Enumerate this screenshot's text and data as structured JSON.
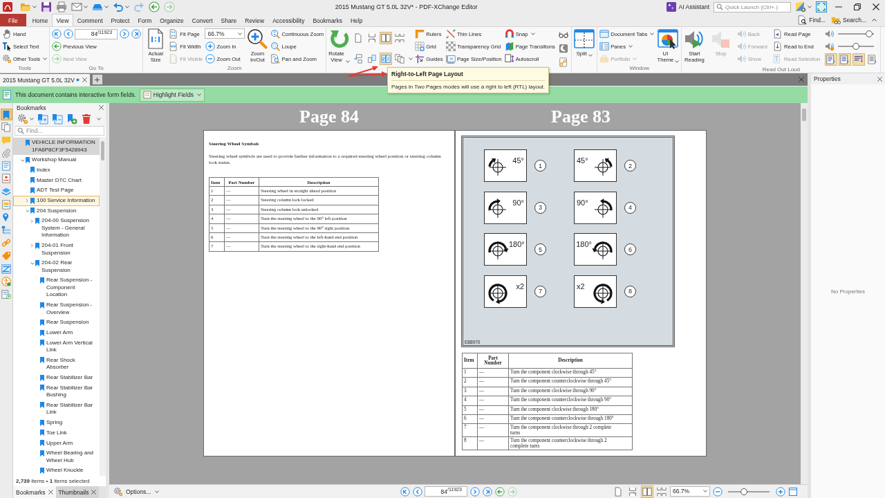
{
  "title_bar": {
    "quick_access": [
      {
        "disabled": false
      },
      {
        "disabled": false
      },
      {
        "disabled": false
      },
      {
        "disabled": false
      },
      {
        "disabled": false
      },
      {
        "disabled": false
      },
      {
        "disabled": true
      },
      {
        "disabled": false
      },
      {
        "disabled": true
      }
    ],
    "title": "2015 Mustang GT 5.0L 32V* - PDF-XChange Editor",
    "ai_button": "AI Assistant",
    "quick_launch": {
      "placeholder": "Quick Launch (Ctrl+.)"
    }
  },
  "menu": {
    "tabs": [
      {
        "label": "File",
        "kind": "file",
        "selected": false
      },
      {
        "label": "Home",
        "kind": "tab",
        "selected": false
      },
      {
        "label": "View",
        "kind": "tab",
        "selected": true
      },
      {
        "label": "Comment",
        "kind": "tab",
        "selected": false
      },
      {
        "label": "Protect",
        "kind": "tab",
        "selected": false
      },
      {
        "label": "Form",
        "kind": "tab",
        "selected": false
      },
      {
        "label": "Organize",
        "kind": "tab",
        "selected": false
      },
      {
        "label": "Convert",
        "kind": "tab",
        "selected": false
      },
      {
        "label": "Share",
        "kind": "tab",
        "selected": false
      },
      {
        "label": "Review",
        "kind": "tab",
        "selected": false
      },
      {
        "label": "Accessibility",
        "kind": "tab",
        "selected": false
      },
      {
        "label": "Bookmarks",
        "kind": "tab",
        "selected": false
      },
      {
        "label": "Help",
        "kind": "tab",
        "selected": false
      }
    ],
    "find": "Find...",
    "search": "Search..."
  },
  "ribbon": [
    {
      "title": "Tools",
      "columns": [
        [
          {
            "kind": "small",
            "label": "Hand",
            "menu": false,
            "disabled": false
          },
          {
            "kind": "small",
            "label": "Select Text",
            "menu": false,
            "disabled": false
          },
          {
            "kind": "small",
            "label": "Other Tools",
            "menu": true,
            "disabled": false
          }
        ]
      ]
    },
    {
      "title": "Go To",
      "columns": [
        [
          {
            "kind": "pager",
            "value": "84",
            "total": "/11923"
          },
          {
            "kind": "small",
            "label": "Previous View",
            "menu": false,
            "disabled": false
          },
          {
            "kind": "small",
            "label": "Next View",
            "menu": false,
            "disabled": true
          }
        ]
      ]
    },
    {
      "title": "Zoom",
      "columns": [
        [
          {
            "kind": "large",
            "label": "Actual Size",
            "menu": false,
            "disabled": false
          }
        ],
        [
          {
            "kind": "small",
            "label": "Fit Page",
            "menu": false,
            "disabled": false
          },
          {
            "kind": "small",
            "label": "Fit Width",
            "menu": false,
            "disabled": false
          },
          {
            "kind": "small",
            "label": "Fit Visible",
            "menu": false,
            "disabled": true
          }
        ],
        [
          {
            "kind": "combo",
            "value": "66.7%"
          },
          {
            "kind": "small",
            "label": "Zoom In",
            "menu": false,
            "disabled": false
          },
          {
            "kind": "small",
            "label": "Zoom Out",
            "menu": false,
            "disabled": false
          }
        ],
        [
          {
            "kind": "large",
            "label": "Zoom In/Out",
            "menu": false,
            "disabled": false
          }
        ],
        [
          {
            "kind": "small",
            "label": "Continuous Zoom",
            "menu": false,
            "disabled": false
          },
          {
            "kind": "small",
            "label": "Loupe",
            "menu": false,
            "disabled": false
          },
          {
            "kind": "small",
            "label": "Pan and Zoom",
            "menu": false,
            "disabled": false
          }
        ]
      ]
    },
    {
      "columns": [
        [
          {
            "kind": "large",
            "label": "Rotate View",
            "menu": true,
            "disabled": false
          }
        ],
        [
          {
            "kind": "icons",
            "menu": false,
            "buttons": [
              {
                "selected": false
              },
              {
                "selected": false
              },
              {
                "selected": true
              },
              {
                "selected": false
              }
            ]
          },
          {
            "kind": "icons",
            "menu": true,
            "buttons": [
              {
                "selected": false
              },
              {
                "selected": false
              },
              {
                "selected": true
              },
              {
                "selected": false
              }
            ]
          }
        ],
        [
          {
            "kind": "small",
            "label": "Rulers",
            "menu": false,
            "disabled": false
          },
          {
            "kind": "small",
            "label": "Grid",
            "menu": false,
            "disabled": false
          },
          {
            "kind": "small",
            "label": "Guides",
            "menu": false,
            "disabled": false
          }
        ],
        [
          {
            "kind": "small",
            "label": "Thin Lines",
            "menu": false,
            "disabled": false
          },
          {
            "kind": "small",
            "label": "Transparency Grid",
            "menu": false,
            "disabled": false
          },
          {
            "kind": "small",
            "label": "Page Size/Position",
            "menu": false,
            "disabled": false
          }
        ],
        [
          {
            "kind": "small",
            "label": "Snap",
            "menu": true,
            "disabled": false
          },
          {
            "kind": "small",
            "label": "Page Transitions",
            "menu": false,
            "disabled": false
          },
          {
            "kind": "small",
            "label": "Autoscroll",
            "menu": false,
            "disabled": false
          }
        ],
        [
          {
            "kind": "icons",
            "menu": false,
            "buttons": [
              {
                "selected": false
              }
            ]
          },
          {
            "kind": "icons",
            "menu": false,
            "buttons": [
              {
                "selected": false
              }
            ]
          },
          {
            "kind": "icons",
            "menu": false,
            "buttons": [
              {
                "selected": false
              }
            ]
          }
        ]
      ]
    },
    {
      "columns": [
        [
          {
            "kind": "large",
            "label": "Split",
            "menu": true,
            "disabled": false
          }
        ]
      ]
    },
    {
      "title": "Window",
      "columns": [
        [
          {
            "kind": "small",
            "label": "Document Tabs",
            "menu": true,
            "disabled": false
          },
          {
            "kind": "small",
            "label": "Panes",
            "menu": true,
            "disabled": false
          },
          {
            "kind": "small",
            "label": "Portfolio",
            "menu": true,
            "disabled": true
          }
        ],
        [
          {
            "kind": "large",
            "label": "UI Theme",
            "menu": true,
            "disabled": false
          }
        ]
      ]
    },
    {
      "title": "Read Out Loud",
      "columns": [
        [
          {
            "kind": "large",
            "label": "Start Reading",
            "menu": false,
            "disabled": false
          }
        ],
        [
          {
            "kind": "large",
            "label": "Stop",
            "menu": false,
            "disabled": true
          }
        ],
        [
          {
            "kind": "small",
            "label": "Back",
            "menu": false,
            "disabled": true
          },
          {
            "kind": "small",
            "label": "Forward",
            "menu": false,
            "disabled": true
          },
          {
            "kind": "small",
            "label": "Show",
            "menu": false,
            "disabled": true
          }
        ],
        [
          {
            "kind": "small",
            "label": "Read Page",
            "menu": false,
            "disabled": false
          },
          {
            "kind": "small",
            "label": "Read to End",
            "menu": false,
            "disabled": false
          },
          {
            "kind": "small",
            "label": "Read Selection",
            "menu": false,
            "disabled": true
          }
        ],
        [
          {
            "kind": "slider",
            "level": 0.95
          },
          {
            "kind": "slider",
            "level": 0.5
          },
          {
            "kind": "icons",
            "menu": false,
            "buttons": [
              {
                "selected": true
              },
              {
                "selected": true
              },
              {
                "selected": true
              },
              {
                "selected": false
              }
            ]
          }
        ]
      ]
    }
  ],
  "document_tabs": [
    {
      "label": "2015 Mustang GT 5.0L 32V",
      "modified": true,
      "selected": true
    }
  ],
  "notification": {
    "message": "This document contains interactive form fields.",
    "button": "Highlight Fields"
  },
  "side_tools": [
    {
      "selected": true
    },
    {
      "selected": false
    },
    {
      "selected": false
    },
    {
      "selected": false
    },
    {
      "selected": false
    },
    {
      "selected": false
    },
    {
      "selected": false
    },
    {
      "selected": false
    },
    {
      "selected": false
    },
    {
      "selected": false
    },
    {
      "selected": false
    },
    {
      "selected": false
    },
    {
      "selected": false
    },
    {
      "selected": false
    },
    {
      "selected": false
    }
  ],
  "bookmarks": {
    "title": "Bookmarks",
    "search": {
      "placeholder": "Find..."
    },
    "items": [
      {
        "label": "VEHICLE INFORMATION 1FA6P8CF3F5428943",
        "kind": "leaf",
        "selected": true,
        "focused": false
      },
      {
        "label": "Workshop Manual",
        "kind": "branch",
        "expanded": true,
        "selected": false,
        "focused": false,
        "children": [
          {
            "label": "Index",
            "kind": "leaf",
            "selected": false,
            "focused": false
          },
          {
            "label": "Master DTC Chart",
            "kind": "leaf",
            "selected": false,
            "focused": false
          },
          {
            "label": "ADT Test Page",
            "kind": "leaf",
            "selected": false,
            "focused": false
          },
          {
            "label": "100 Service Information",
            "kind": "branch",
            "expanded": false,
            "selected": false,
            "focused": true
          },
          {
            "label": "204 Suspension",
            "kind": "branch",
            "expanded": true,
            "selected": false,
            "focused": false,
            "children": [
              {
                "label": "204-00 Suspension System - General Information",
                "kind": "branch",
                "expanded": false,
                "selected": false,
                "focused": false
              },
              {
                "label": "204-01 Front Suspension",
                "kind": "branch",
                "expanded": false,
                "selected": false,
                "focused": false
              },
              {
                "label": "204-02 Rear Suspension",
                "kind": "branch",
                "expanded": true,
                "selected": false,
                "focused": false,
                "children": [
                  {
                    "label": "Rear Suspension - Component Location",
                    "kind": "leaf",
                    "selected": false,
                    "focused": false
                  },
                  {
                    "label": "Rear Suspension - Overview",
                    "kind": "leaf",
                    "selected": false,
                    "focused": false
                  },
                  {
                    "label": "Rear Suspension",
                    "kind": "leaf",
                    "selected": false,
                    "focused": false
                  },
                  {
                    "label": "Lower Arm",
                    "kind": "leaf",
                    "selected": false,
                    "focused": false
                  },
                  {
                    "label": "Lower Arm Vertical Link",
                    "kind": "leaf",
                    "selected": false,
                    "focused": false
                  },
                  {
                    "label": "Rear Shock Absorber",
                    "kind": "leaf",
                    "selected": false,
                    "focused": false
                  },
                  {
                    "label": "Rear Stabilizer Bar",
                    "kind": "leaf",
                    "selected": false,
                    "focused": false
                  },
                  {
                    "label": "Rear Stabilizer Bar Bushing",
                    "kind": "leaf",
                    "selected": false,
                    "focused": false
                  },
                  {
                    "label": "Rear Stabilizer Bar Link",
                    "kind": "leaf",
                    "selected": false,
                    "focused": false
                  },
                  {
                    "label": "Spring",
                    "kind": "leaf",
                    "selected": false,
                    "focused": false
                  },
                  {
                    "label": "Toe Link",
                    "kind": "leaf",
                    "selected": false,
                    "focused": false
                  },
                  {
                    "label": "Upper Arm",
                    "kind": "leaf",
                    "selected": false,
                    "focused": false
                  },
                  {
                    "label": "Wheel Bearing and Wheel Hub",
                    "kind": "leaf",
                    "selected": false,
                    "focused": false
                  },
                  {
                    "label": "Wheel Knuckle",
                    "kind": "leaf",
                    "selected": false,
                    "focused": false
                  }
                ]
              }
            ]
          }
        ]
      }
    ],
    "status": "**2,739** items • **1** items selected",
    "tabs": [
      {
        "label": "Bookmarks",
        "selected": true
      },
      {
        "label": "Thumbnails",
        "selected": false
      }
    ]
  },
  "document": {
    "pages": [
      {
        "label": "Page 84",
        "kind": "text",
        "heading": "Steering Wheel Symbols",
        "paragraph": "Steering wheel symbols are used to provide further information to a required steering wheel position or steering column lock status.",
        "table": {
          "columns": [
            "Item",
            "Part Number",
            "Description"
          ],
          "rows": [
            [
              "1",
              "—",
              "Steering wheel in straight ahead position"
            ],
            [
              "2",
              "—",
              "Steering column lock locked"
            ],
            [
              "3",
              "—",
              "Steering column lock unlocked"
            ],
            [
              "4",
              "—",
              "Turn the steering wheel to the 90° left position"
            ],
            [
              "5",
              "—",
              "Turn the steering wheel to the 90° right position"
            ],
            [
              "6",
              "—",
              "Turn the steering wheel to the left-hand end position"
            ],
            [
              "7",
              "—",
              "Turn the steering wheel to the right-hand end position"
            ]
          ]
        }
      },
      {
        "label": "Page 83",
        "kind": "figure",
        "figure": {
          "symbols": [
            {
              "kind": "eighth",
              "mirrored": false,
              "label": "45°",
              "number": "1"
            },
            {
              "kind": "eighth",
              "mirrored": true,
              "label": "45°",
              "number": "2"
            },
            {
              "kind": "quarter",
              "mirrored": false,
              "label": "90°",
              "number": "3"
            },
            {
              "kind": "quarter",
              "mirrored": true,
              "label": "90°",
              "number": "4"
            },
            {
              "kind": "half",
              "mirrored": false,
              "label": "180°",
              "number": "5"
            },
            {
              "kind": "half",
              "mirrored": true,
              "label": "180°",
              "number": "6"
            },
            {
              "kind": "double",
              "mirrored": false,
              "label": "x2",
              "number": "7"
            },
            {
              "kind": "double",
              "mirrored": true,
              "label": "x2",
              "number": "8"
            }
          ],
          "code": "E88970"
        },
        "table": {
          "columns": [
            "Item",
            "Part Number",
            "Description"
          ],
          "rows": [
            [
              "1",
              "—",
              "Turn the component clockwise through 45°"
            ],
            [
              "2",
              "—",
              "Turn the component counterclockwise through 45°"
            ],
            [
              "3",
              "—",
              "Turn the component clockwise through 90°"
            ],
            [
              "4",
              "—",
              "Turn the component counterclockwise through 90°"
            ],
            [
              "5",
              "—",
              "Turn the component clockwise through 180°"
            ],
            [
              "6",
              "—",
              "Turn the component counterclockwise through 180°"
            ],
            [
              "7",
              "—",
              "Turn the component clockwise through 2 complete turns"
            ],
            [
              "8",
              "—",
              "Turn the component counterclockwise through 2 complete turns"
            ]
          ]
        }
      }
    ]
  },
  "status_bar": {
    "options": "Options...",
    "page": {
      "value": "84",
      "total": "/11923"
    },
    "history": [
      {
        "disabled": false
      },
      {
        "disabled": true
      }
    ],
    "layouts": [
      {
        "selected": false
      },
      {
        "selected": false
      },
      {
        "selected": true
      },
      {
        "selected": false
      }
    ],
    "zoom": "66.7%",
    "zoom_slider": {
      "level": 0.35
    }
  },
  "properties": {
    "title": "Properties",
    "message": "No Properties"
  },
  "tooltip": {
    "title": "Right-to-Left Page Layout",
    "text": "Pages in Two Pages modes will use a right to left (RTL) layout."
  }
}
